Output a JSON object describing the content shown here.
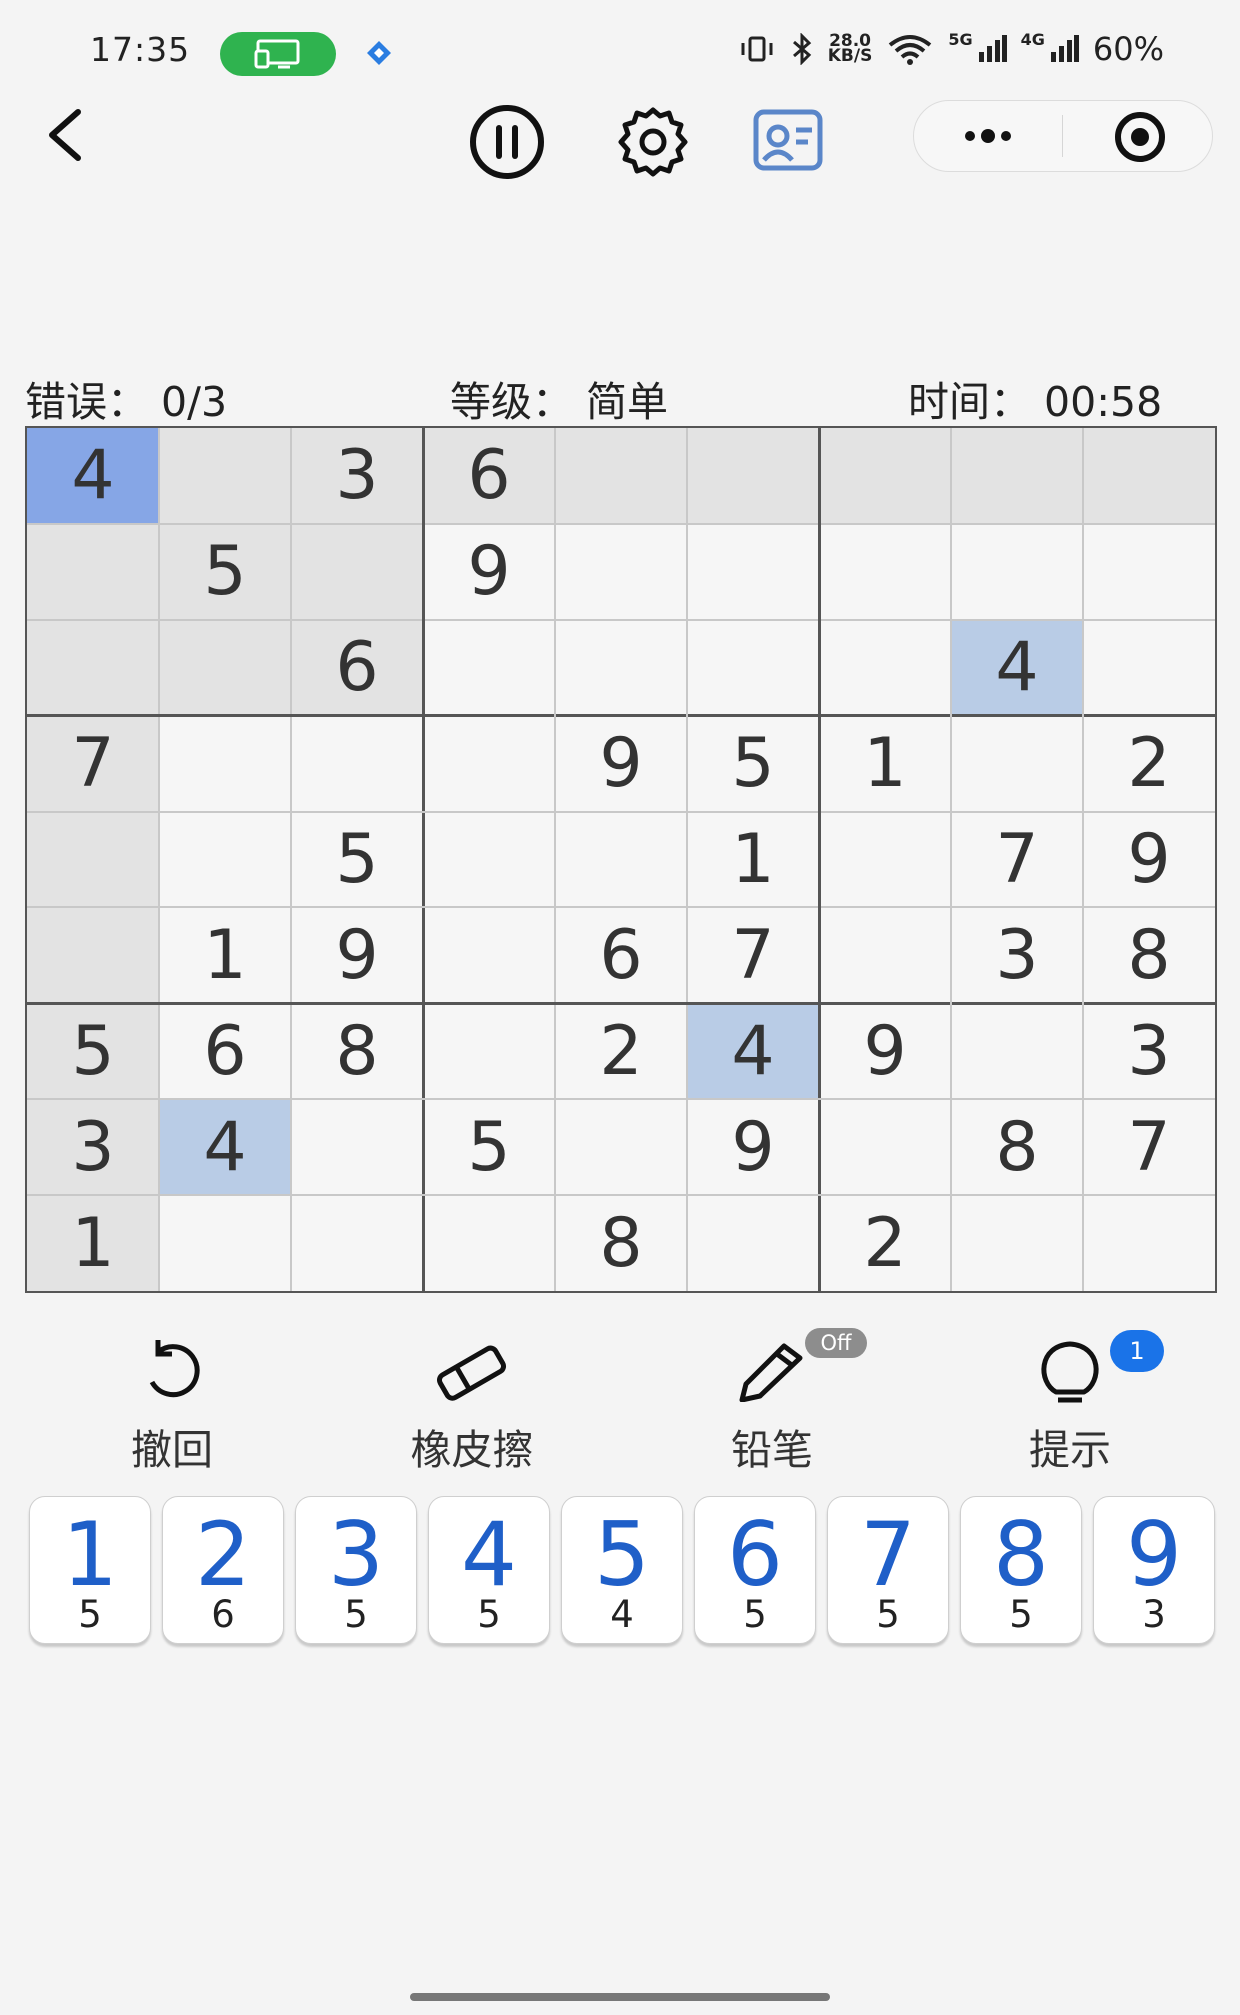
{
  "status_bar": {
    "time": "17:35",
    "speed_value": "28.0",
    "speed_unit": "KB/S",
    "net_5g": "5G",
    "net_4g": "4G",
    "battery": "60%",
    "icons": [
      "screen-cast-icon",
      "app-notification-icon",
      "vibrate-icon",
      "bluetooth-icon",
      "wifi-icon",
      "signal-icon"
    ]
  },
  "toolbar": {
    "icons": [
      "back-icon",
      "pause-icon",
      "settings-icon",
      "ranking-icon",
      "more-icon",
      "close-target-icon"
    ]
  },
  "info": {
    "errors_label": "错误：",
    "errors_value": "0/3",
    "level_label": "等级：",
    "level_value": "简单",
    "time_label": "时间：",
    "time_value": "00:58"
  },
  "board": {
    "grid": [
      [
        4,
        0,
        3,
        6,
        0,
        0,
        0,
        0,
        0
      ],
      [
        0,
        5,
        0,
        9,
        0,
        0,
        0,
        0,
        0
      ],
      [
        0,
        0,
        6,
        0,
        0,
        0,
        0,
        4,
        0
      ],
      [
        7,
        0,
        0,
        0,
        9,
        5,
        1,
        0,
        2
      ],
      [
        0,
        0,
        5,
        0,
        0,
        1,
        0,
        7,
        9
      ],
      [
        0,
        1,
        9,
        0,
        6,
        7,
        0,
        3,
        8
      ],
      [
        5,
        6,
        8,
        0,
        2,
        4,
        9,
        0,
        3
      ],
      [
        3,
        4,
        0,
        5,
        0,
        9,
        0,
        8,
        7
      ],
      [
        1,
        0,
        0,
        0,
        8,
        0,
        2,
        0,
        0
      ]
    ],
    "selected": [
      0,
      0
    ]
  },
  "tools": [
    {
      "label": "撤回",
      "icon": "undo-icon"
    },
    {
      "label": "橡皮擦",
      "icon": "eraser-icon"
    },
    {
      "label": "铅笔",
      "icon": "pencil-icon",
      "badge": "Off"
    },
    {
      "label": "提示",
      "icon": "lightbulb-icon",
      "badge": "1"
    }
  ],
  "numpad": [
    {
      "digit": "1",
      "remaining": "5"
    },
    {
      "digit": "2",
      "remaining": "6"
    },
    {
      "digit": "3",
      "remaining": "5"
    },
    {
      "digit": "4",
      "remaining": "5"
    },
    {
      "digit": "5",
      "remaining": "4"
    },
    {
      "digit": "6",
      "remaining": "5"
    },
    {
      "digit": "7",
      "remaining": "5"
    },
    {
      "digit": "8",
      "remaining": "5"
    },
    {
      "digit": "9",
      "remaining": "3"
    }
  ],
  "colors": {
    "selected_cell": "#86a6e6",
    "same_number": "#b9cce6",
    "related_cell": "#e3e3e3",
    "numpad_digit": "#1f5fc8",
    "hint_badge": "#1a73e8"
  }
}
